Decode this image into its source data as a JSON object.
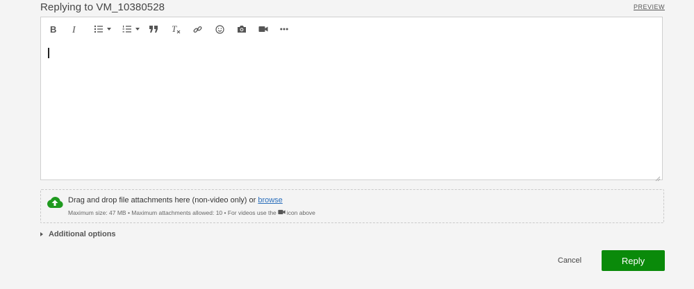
{
  "header": {
    "title": "Replying to VM_10380528",
    "preview_label": "PREVIEW"
  },
  "toolbar": {
    "buttons": [
      {
        "name": "bold-icon"
      },
      {
        "name": "italic-icon"
      },
      {
        "name": "bulleted-list-icon"
      },
      {
        "name": "numbered-list-icon"
      },
      {
        "name": "quote-icon"
      },
      {
        "name": "clear-formatting-icon"
      },
      {
        "name": "link-icon"
      },
      {
        "name": "emoji-icon"
      },
      {
        "name": "camera-icon"
      },
      {
        "name": "video-icon"
      },
      {
        "name": "more-icon"
      }
    ]
  },
  "dropzone": {
    "text": "Drag and drop file attachments here (non-video only) or ",
    "browse_label": "browse",
    "limits_prefix": "Maximum size: 47 MB • Maximum attachments allowed: 10 • For videos use the",
    "limits_suffix": "icon above",
    "icon_color": "#1f9a1f"
  },
  "additional_options": {
    "label": "Additional options"
  },
  "actions": {
    "cancel_label": "Cancel",
    "reply_label": "Reply",
    "reply_color": "#0a8a0a"
  }
}
